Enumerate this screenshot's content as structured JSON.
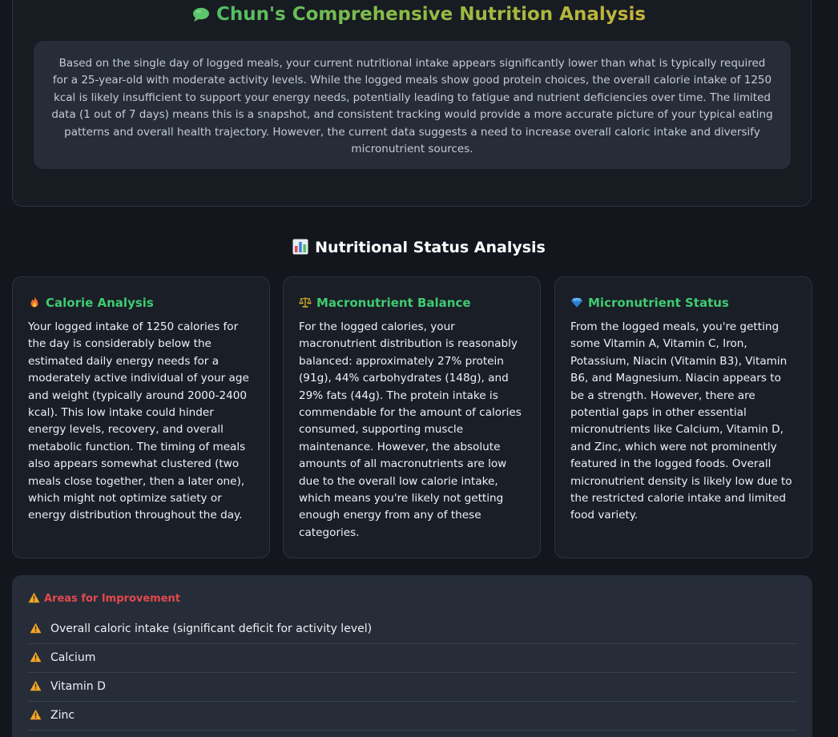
{
  "header": {
    "icon": "speech-bubble-icon",
    "title": "Chun's Comprehensive Nutrition Analysis",
    "summary": "Based on the single day of logged meals, your current nutritional intake appears significantly lower than what is typically required for a 25-year-old with moderate activity levels. While the logged meals show good protein choices, the overall calorie intake of 1250 kcal is likely insufficient to support your energy needs, potentially leading to fatigue and nutrient deficiencies over time. The limited data (1 out of 7 days) means this is a snapshot, and consistent tracking would provide a more accurate picture of your typical eating patterns and overall health trajectory. However, the current data suggests a need to increase overall caloric intake and diversify micronutrient sources."
  },
  "status_section": {
    "icon": "bar-chart-icon",
    "title": "Nutritional Status Analysis",
    "cards": [
      {
        "icon": "fire-icon",
        "title": "Calorie Analysis",
        "body": "Your logged intake of 1250 calories for the day is considerably below the estimated daily energy needs for a moderately active individual of your age and weight (typically around 2000-2400 kcal). This low intake could hinder energy levels, recovery, and overall metabolic function. The timing of meals also appears somewhat clustered (two meals close together, then a later one), which might not optimize satiety or energy distribution throughout the day."
      },
      {
        "icon": "balance-scale-icon",
        "title": "Macronutrient Balance",
        "body": "For the logged calories, your macronutrient distribution is reasonably balanced: approximately 27% protein (91g), 44% carbohydrates (148g), and 29% fats (44g). The protein intake is commendable for the amount of calories consumed, supporting muscle maintenance. However, the absolute amounts of all macronutrients are low due to the overall low calorie intake, which means you're likely not getting enough energy from any of these categories."
      },
      {
        "icon": "gem-icon",
        "title": "Micronutrient Status",
        "body": "From the logged meals, you're getting some Vitamin A, Vitamin C, Iron, Potassium, Niacin (Vitamin B3), Vitamin B6, and Magnesium. Niacin appears to be a strength. However, there are potential gaps in other essential micronutrients like Calcium, Vitamin D, and Zinc, which were not prominently featured in the logged foods. Overall micronutrient density is likely low due to the restricted calorie intake and limited food variety."
      }
    ]
  },
  "improvement": {
    "icon": "warning-icon",
    "title": "Areas for Improvement",
    "items": [
      "Overall caloric intake (significant deficit for activity level)",
      "Calcium",
      "Vitamin D",
      "Zinc",
      ""
    ]
  },
  "colors": {
    "title_gradient": [
      "#4fbf63",
      "#c8b43a"
    ],
    "card_accent": "#3fca71",
    "improvement_accent": "#e5484d",
    "warning_icon": "#f5a524"
  }
}
